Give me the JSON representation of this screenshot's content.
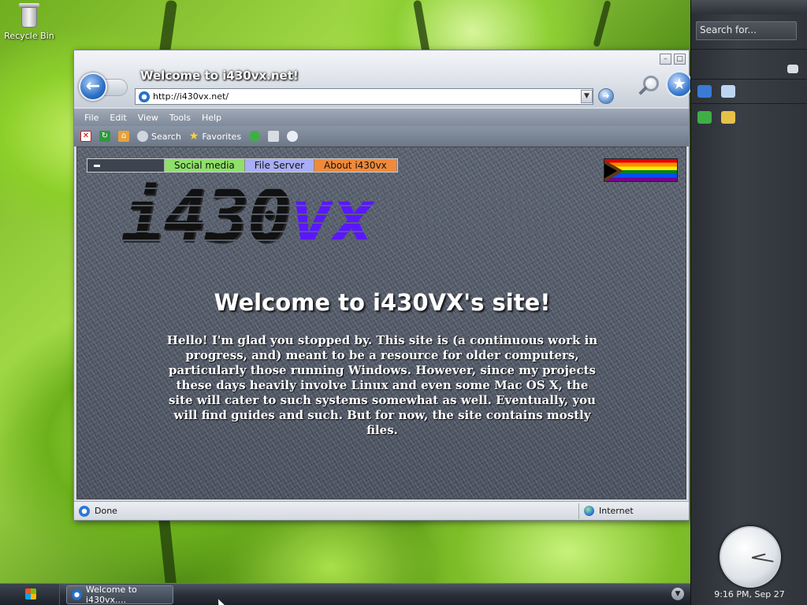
{
  "desktop": {
    "icons": [
      {
        "label": "Recycle Bin",
        "icon": "recycle-bin-icon"
      }
    ]
  },
  "browser": {
    "window_title": "Welcome to i430vx.net!",
    "address": "http://i430vx.net/",
    "menu": [
      "File",
      "Edit",
      "View",
      "Tools",
      "Help"
    ],
    "toolbar": {
      "search_label": "Search",
      "favorites_label": "Favorites"
    },
    "window_buttons": [
      "–",
      "□",
      "×"
    ],
    "status": {
      "left": "Done",
      "zone": "Internet"
    }
  },
  "site": {
    "nav": [
      {
        "label": "Social media",
        "color": "#8fe06a"
      },
      {
        "label": "File Server",
        "color": "#a9aef5"
      },
      {
        "label": "About i430vx",
        "color": "#f08a3a"
      }
    ],
    "logo": {
      "part1": "i430",
      "part2": "vx",
      "color1": "#111111",
      "color2": "#5a17ff"
    },
    "heading": "Welcome to i430VX's site!",
    "intro": "Hello! I'm glad you stopped by. This site is (a continuous work in progress, and) meant to be a resource for older computers, particularly those running Windows. However, since my projects these days heavily involve Linux and even some Mac OS X, the site will cater to such systems somewhat as well. Eventually, you will find guides and such. But for now, the site contains mostly files."
  },
  "sidebar": {
    "search_placeholder": "Search for...",
    "clock_label": "9:16 PM, Sep 27"
  },
  "taskbar": {
    "task_label": "Welcome to i430vx...."
  }
}
